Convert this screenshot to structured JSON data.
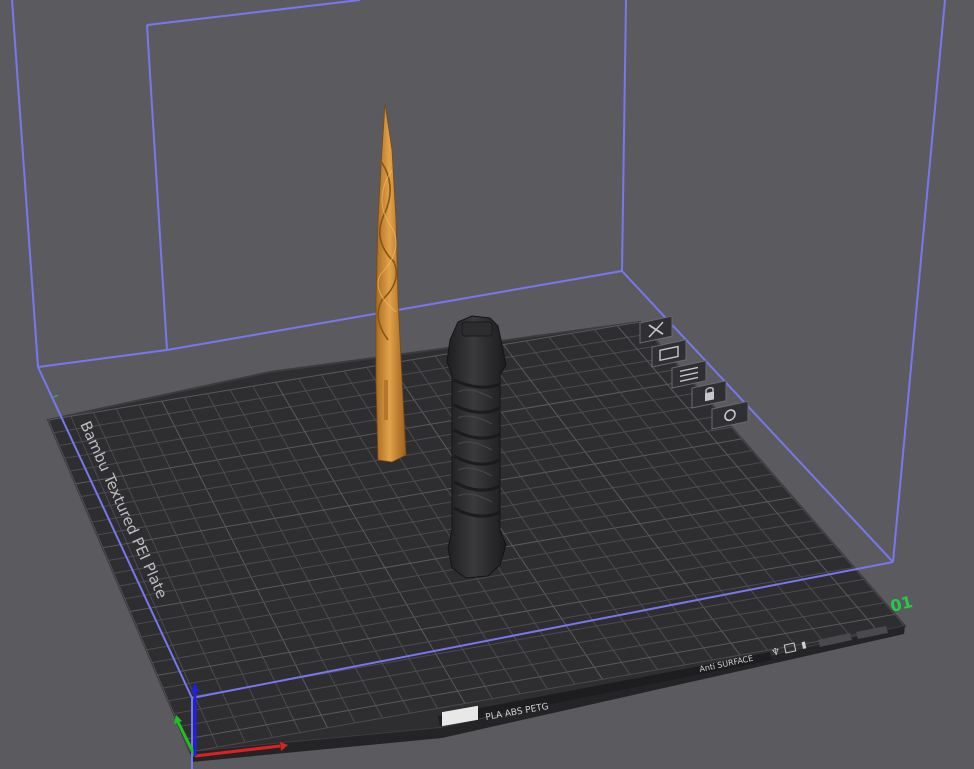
{
  "plate": {
    "name": "Bambu Textured PEI Plate",
    "number": "01",
    "filament_label": "PLA ABS PETG",
    "surface_label": "Anti SURFACE"
  },
  "toolbar": {
    "buttons": [
      {
        "id": "close",
        "icon": "close-icon"
      },
      {
        "id": "arrange",
        "icon": "arrange-icon"
      },
      {
        "id": "slice-preview",
        "icon": "slice-icon"
      },
      {
        "id": "lock",
        "icon": "lock-icon"
      },
      {
        "id": "settings",
        "icon": "gear-icon"
      }
    ]
  },
  "colors": {
    "background": "#5b5b5f",
    "plate": "#2e2e31",
    "grid": "#4a4a4e",
    "build_volume": "#7777ee",
    "model_orange": "#c98a34",
    "model_black": "#2a2a2c",
    "axis_x": "#e02020",
    "axis_y": "#20c020",
    "axis_z": "#2020e0",
    "plate_number": "#22cc44"
  }
}
